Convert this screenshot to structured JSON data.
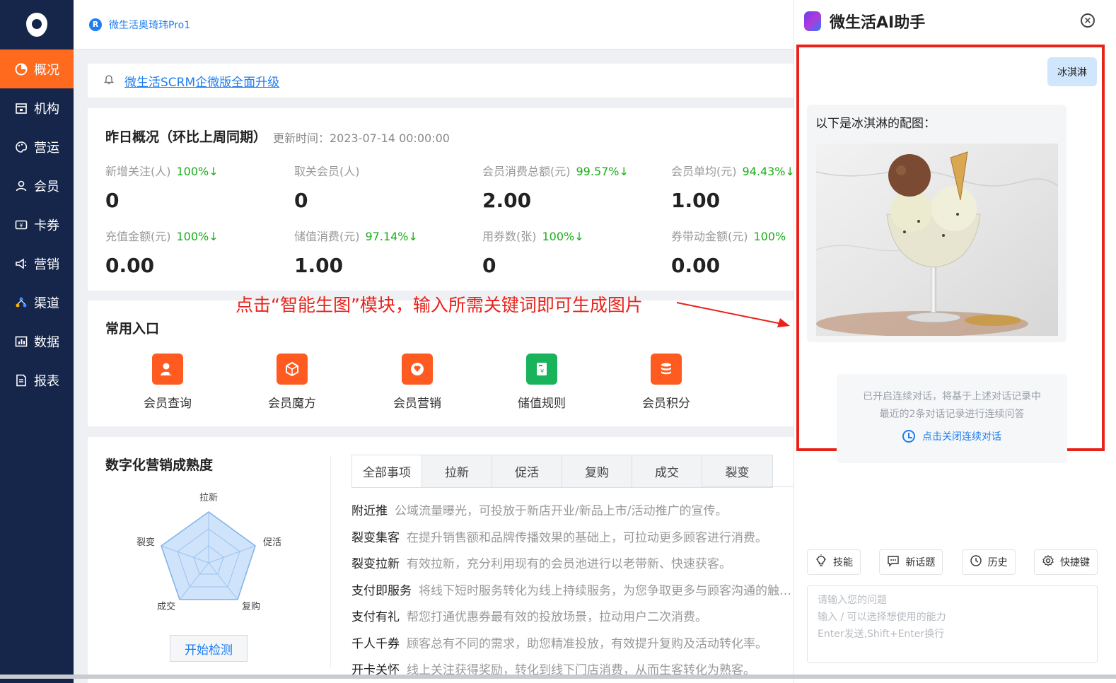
{
  "sidebar": {
    "logo": "logo-icon",
    "items": [
      {
        "label": "概况",
        "icon": "pie-chart-icon",
        "active": true
      },
      {
        "label": "机构",
        "icon": "building-icon"
      },
      {
        "label": "营运",
        "icon": "palette-icon"
      },
      {
        "label": "会员",
        "icon": "user-icon"
      },
      {
        "label": "卡券",
        "icon": "ticket-icon"
      },
      {
        "label": "营销",
        "icon": "megaphone-icon"
      },
      {
        "label": "渠道",
        "icon": "network-icon"
      },
      {
        "label": "数据",
        "icon": "bar-chart-icon"
      },
      {
        "label": "报表",
        "icon": "report-icon"
      }
    ],
    "active_color": "#ff6a1f",
    "bg_color": "#16264b"
  },
  "topbar": {
    "badge": "R",
    "store_name": "微生活奥琦玮Pro1"
  },
  "notice": {
    "text": "微生活SCRM企微版全面升级"
  },
  "overview": {
    "title": "昨日概况（环比上周同期）",
    "update_time": "更新时间：2023-07-14 00:00:00",
    "stats": [
      {
        "label": "新增关注(人)",
        "pct": "100%↓",
        "value": "0"
      },
      {
        "label": "取关会员(人)",
        "pct": "",
        "value": "0"
      },
      {
        "label": "会员消费总额(元)",
        "pct": "99.57%↓",
        "value": "2.00"
      },
      {
        "label": "会员单均(元)",
        "pct": "94.43%↓",
        "value": "1.00"
      },
      {
        "label": "充值金额(元)",
        "pct": "100%↓",
        "value": "0.00"
      },
      {
        "label": "储值消费(元)",
        "pct": "97.14%↓",
        "value": "1.00"
      },
      {
        "label": "用券数(张)",
        "pct": "100%↓",
        "value": "0"
      },
      {
        "label": "券带动金额(元)",
        "pct": "100%",
        "value": "0.00"
      }
    ]
  },
  "entries": {
    "title": "常用入口",
    "items": [
      {
        "label": "会员查询",
        "icon": "member-search-icon",
        "color": "#ff5a1f"
      },
      {
        "label": "会员魔方",
        "icon": "cube-icon",
        "color": "#ff5a1f"
      },
      {
        "label": "会员营销",
        "icon": "diamond-icon",
        "color": "#ff5a1f"
      },
      {
        "label": "储值规则",
        "icon": "book-icon",
        "color": "#19b35c"
      },
      {
        "label": "会员积分",
        "icon": "coins-icon",
        "color": "#ff5a1f"
      }
    ]
  },
  "maturity": {
    "title": "数字化营销成熟度",
    "radar_labels": [
      "拉新",
      "促活",
      "复购",
      "成交",
      "裂变"
    ],
    "start_button": "开始检测",
    "tabs": [
      "全部事项",
      "拉新",
      "促活",
      "复购",
      "成交",
      "裂变"
    ],
    "items": [
      {
        "k": "附近推",
        "d": "公域流量曝光，可投放于新店开业/新品上市/活动推广的宣传。"
      },
      {
        "k": "裂变集客",
        "d": "在提升销售额和品牌传播效果的基础上，可拉动更多顾客进行消费。"
      },
      {
        "k": "裂变拉新",
        "d": "有效拉新，充分利用现有的会员池进行以老带新、快速获客。"
      },
      {
        "k": "支付即服务",
        "d": "将线下短时服务转化为线上持续服务，为您争取更多与顾客沟通的触…"
      },
      {
        "k": "支付有礼",
        "d": "帮您打通优惠券最有效的投放场景，拉动用户二次消费。"
      },
      {
        "k": "千人千券",
        "d": "顾客总有不同的需求，助您精准投放，有效提升复购及活动转化率。"
      },
      {
        "k": "开卡关怀",
        "d": "线上关注获得奖励，转化到线下门店消费，从而生客转化为熟客。"
      }
    ]
  },
  "annotation": {
    "text": "点击“智能生图”模块，输入所需关键词即可生成图片",
    "color": "#e8221b"
  },
  "ai_panel": {
    "title": "微生活AI助手",
    "user_message": "冰淇淋",
    "bot_message": "以下是冰淇淋的配图：",
    "system_note_1": "已开启连续对话，将基于上述对话记录中",
    "system_note_2": "最近的2条对话记录进行连续问答",
    "close_continuous": "点击关闭连续对话",
    "toolbar": [
      {
        "label": "技能",
        "icon": "bulb-icon"
      },
      {
        "label": "新话题",
        "icon": "chat-icon"
      },
      {
        "label": "历史",
        "icon": "history-icon"
      },
      {
        "label": "快捷键",
        "icon": "gear-icon"
      }
    ],
    "placeholder_1": "请输入您的问题",
    "placeholder_2": "输入 / 可以选择想使用的能力",
    "placeholder_3": "Enter发送,Shift+Enter换行"
  }
}
